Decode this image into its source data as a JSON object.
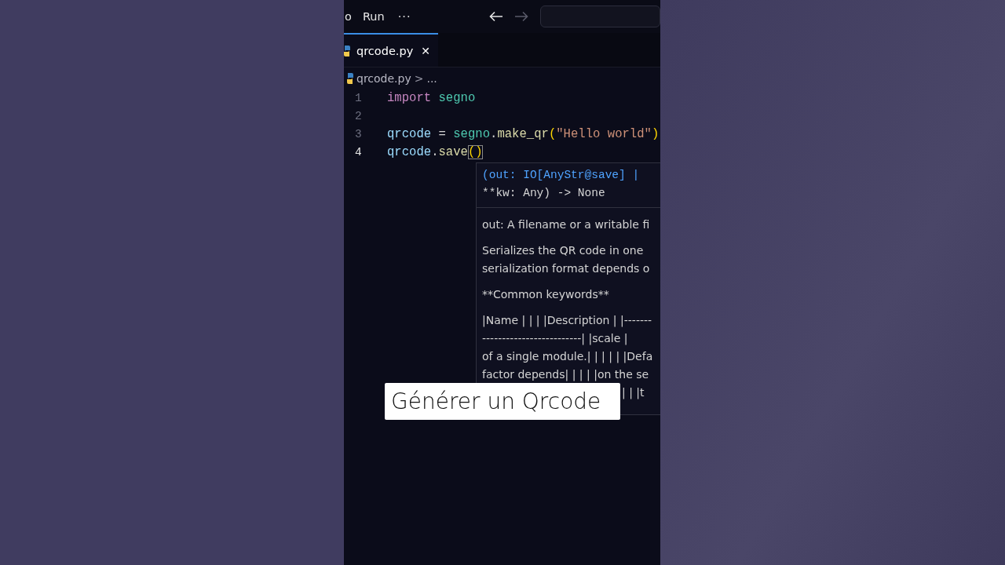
{
  "menu": [
    {
      "label": "o"
    },
    {
      "label": "Run"
    }
  ],
  "more": "···",
  "nav": [
    {
      "kind": "back",
      "disabled": false
    },
    {
      "kind": "forward",
      "disabled": true
    }
  ],
  "tabs": [
    {
      "label": "qrcode.py",
      "selected": true,
      "close": "✕"
    }
  ],
  "breadcrumb": {
    "file": "qrcode.py",
    "separator": ">",
    "rest": "..."
  },
  "code": [
    {
      "number": "1",
      "current": false,
      "tokens": [
        {
          "text": "import ",
          "kind": "keyword"
        },
        {
          "text": "segno",
          "kind": "module"
        }
      ]
    },
    {
      "number": "2",
      "current": false
    },
    {
      "number": "3",
      "current": false,
      "tokens": [
        {
          "text": "qrcode",
          "kind": "variable"
        },
        {
          "text": " = ",
          "kind": "plain"
        },
        {
          "text": "segno",
          "kind": "module"
        },
        {
          "text": ".",
          "kind": "plain"
        },
        {
          "text": "make_qr",
          "kind": "function"
        },
        {
          "text": "(",
          "kind": "bracket"
        },
        {
          "text": "\"Hello world\"",
          "kind": "string"
        },
        {
          "text": ")",
          "kind": "bracket"
        }
      ]
    },
    {
      "number": "4",
      "current": true,
      "tokens": [
        {
          "text": "qrcode",
          "kind": "variable"
        },
        {
          "text": ".",
          "kind": "plain"
        },
        {
          "text": "save",
          "kind": "function"
        },
        {
          "text": "()",
          "kind": "bracket-match"
        }
      ]
    }
  ],
  "hover": {
    "signature": [
      "(out: IO[AnyStr@save] |",
      "**kw: Any) -> None"
    ],
    "paragraphs": [
      [
        "out: A filename or a writable fi"
      ],
      [
        "Serializes the QR code in one",
        "serialization format depends o"
      ],
      [
        "**Common keywords**"
      ],
      [
        "|Name | | | |Description | |-------",
        "-------------------------| |scale |",
        "of a single module.| | | | | |Defa",
        "factor depends| | | | |on the se",
        "| | |t"
      ]
    ]
  },
  "caption": "Générer un Qrcode"
}
